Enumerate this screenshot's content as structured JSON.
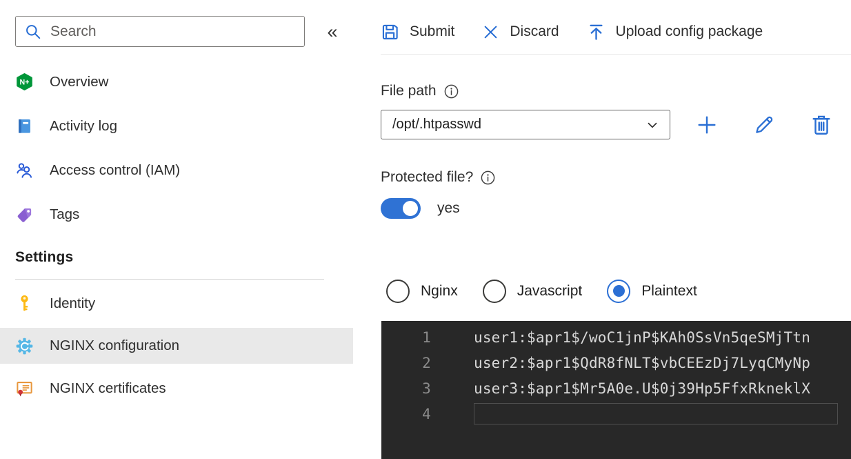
{
  "colors": {
    "accent_blue": "#2b6fd4",
    "toggle_on_blue": "#2f72d4",
    "nginx_green": "#009639",
    "selected_row_bg": "#e9e9e9",
    "editor_bg": "#282828",
    "editor_line_number": "#8c8c8c",
    "editor_text": "#d8d8d8"
  },
  "sidebar": {
    "search": {
      "placeholder": "Search"
    },
    "collapse_glyph": "«",
    "items": [
      {
        "label": "Overview",
        "icon": "nginx-logo-icon"
      },
      {
        "label": "Activity log",
        "icon": "book-icon"
      },
      {
        "label": "Access control (IAM)",
        "icon": "people-icon"
      },
      {
        "label": "Tags",
        "icon": "tag-icon"
      }
    ],
    "settings": {
      "header": "Settings",
      "items": [
        {
          "label": "Identity",
          "icon": "key-icon",
          "selected": false
        },
        {
          "label": "NGINX configuration",
          "icon": "gear-icon",
          "selected": true
        },
        {
          "label": "NGINX certificates",
          "icon": "certificate-icon",
          "selected": false
        }
      ]
    }
  },
  "toolbar": {
    "submit_label": "Submit",
    "discard_label": "Discard",
    "upload_label": "Upload config package"
  },
  "file_path": {
    "label": "File path",
    "value": "/opt/.htpasswd"
  },
  "protected_file": {
    "label": "Protected file?",
    "state_label": "yes",
    "on": true
  },
  "format_options": [
    {
      "label": "Nginx",
      "selected": false
    },
    {
      "label": "Javascript",
      "selected": false
    },
    {
      "label": "Plaintext",
      "selected": true
    }
  ],
  "editor": {
    "lines": [
      {
        "number": "1",
        "text": "user1:$apr1$/woC1jnP$KAh0SsVn5qeSMjTtn"
      },
      {
        "number": "2",
        "text": "user2:$apr1$QdR8fNLT$vbCEEzDj7LyqCMyNp"
      },
      {
        "number": "3",
        "text": "user3:$apr1$Mr5A0e.U$0j39Hp5FfxRkneklX"
      },
      {
        "number": "4",
        "text": "",
        "cursor": true
      }
    ]
  }
}
